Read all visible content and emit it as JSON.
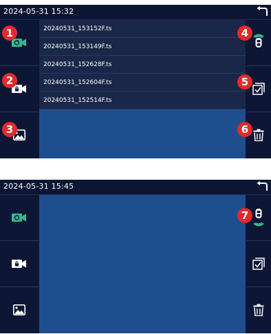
{
  "screen1": {
    "datetime": "2024-05-31  15:32",
    "files": [
      "20240531_153152F.ts",
      "20240531_153149F.ts",
      "20240531_152628F.ts",
      "20240531_152604F.ts",
      "20240531_152514F.ts"
    ],
    "badges": [
      "1",
      "2",
      "3",
      "4",
      "5",
      "6"
    ]
  },
  "screen2": {
    "datetime": "2024-05-31  15:45",
    "badges": [
      "7"
    ]
  },
  "icons": {
    "back": "back-arrow-icon",
    "video": "video-camera-icon",
    "locked_video": "locked-video-icon",
    "photo": "photo-gallery-icon",
    "camera_switch": "front-rear-camera-icon",
    "select": "multi-select-checkbox-icon",
    "delete": "trash-can-icon"
  },
  "colors": {
    "video_icon_active": "#36b68f",
    "content_bg": "#1f4e8f",
    "badge": "#e12a2a"
  }
}
